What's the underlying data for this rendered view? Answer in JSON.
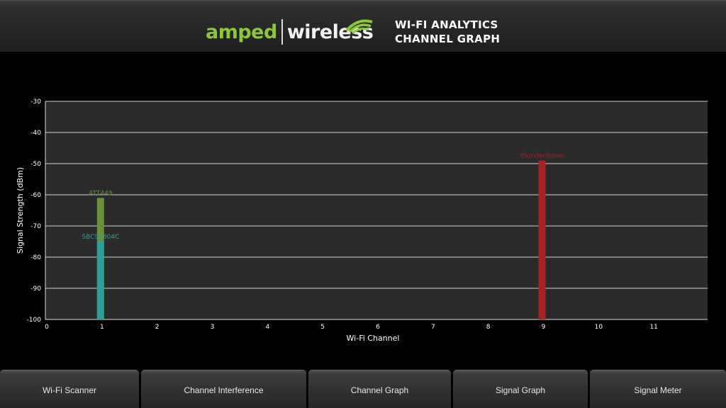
{
  "header": {
    "logo_left": "amped",
    "logo_right": "wireless",
    "title_line1": "WI-FI ANALYTICS",
    "title_line2": "CHANNEL GRAPH"
  },
  "colors": {
    "brand_green": "#8cc63f",
    "plot_bg": "#2b2b2b",
    "grid": "#cfcfcf"
  },
  "chart_data": {
    "type": "bar",
    "xlabel": "Wi-Fi Channel",
    "ylabel": "Signal Strength (dBm)",
    "xlim": [
      0,
      12
    ],
    "ylim": [
      -100,
      -30
    ],
    "x_ticks": [
      0,
      1,
      2,
      3,
      4,
      5,
      6,
      7,
      8,
      9,
      10,
      11
    ],
    "y_ticks": [
      -30,
      -40,
      -50,
      -60,
      -70,
      -80,
      -90,
      -100
    ],
    "grid": true,
    "series": [
      {
        "name": "ATT449",
        "channel": 1,
        "value": -61,
        "color": "#6b8e3a"
      },
      {
        "name": "SBC95804C",
        "channel": 1,
        "value": -75,
        "color": "#2f9c98"
      },
      {
        "name": "thunderdome",
        "channel": 9,
        "value": -49,
        "color": "#a32525"
      }
    ]
  },
  "nav": {
    "items": [
      {
        "label": "Wi-Fi Scanner"
      },
      {
        "label": "Channel Interference"
      },
      {
        "label": "Channel Graph"
      },
      {
        "label": "Signal Graph"
      },
      {
        "label": "Signal Meter"
      }
    ]
  }
}
